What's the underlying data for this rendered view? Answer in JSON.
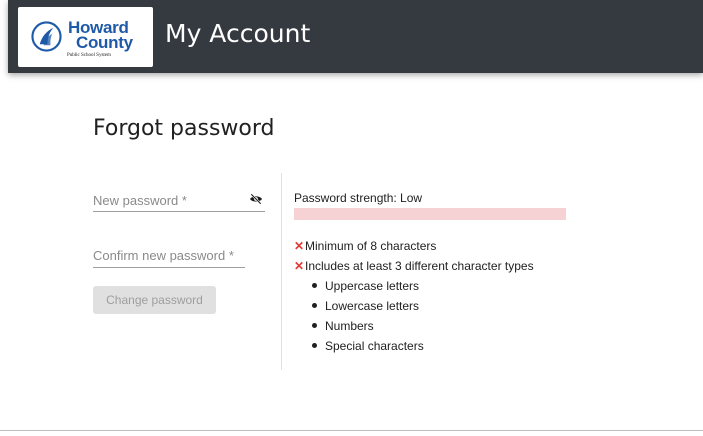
{
  "header": {
    "logo": {
      "line1": "Howard",
      "line2": "County",
      "line3": "Public School System"
    },
    "app_title": "My Account"
  },
  "form": {
    "title": "Forgot password",
    "new_password_placeholder": "New password *",
    "new_password_value": "",
    "confirm_password_placeholder": "Confirm new password *",
    "confirm_password_value": "",
    "submit_label": "Change password",
    "submit_disabled": true
  },
  "strength": {
    "label": "Password strength: Low",
    "level": "Low",
    "color": "#f6d2d5"
  },
  "requirements": [
    {
      "text": "Minimum of 8 characters",
      "met": false
    },
    {
      "text": "Includes at least 3 different character types",
      "met": false
    }
  ],
  "character_types": [
    "Uppercase letters",
    "Lowercase letters",
    "Numbers",
    "Special characters"
  ],
  "icons": {
    "toggle_visibility": "eye-slash-icon",
    "unmet_requirement": "cross-icon"
  },
  "colors": {
    "header_bg": "#343a40",
    "brand_blue": "#1f5aa8",
    "error_red": "#e53935"
  }
}
